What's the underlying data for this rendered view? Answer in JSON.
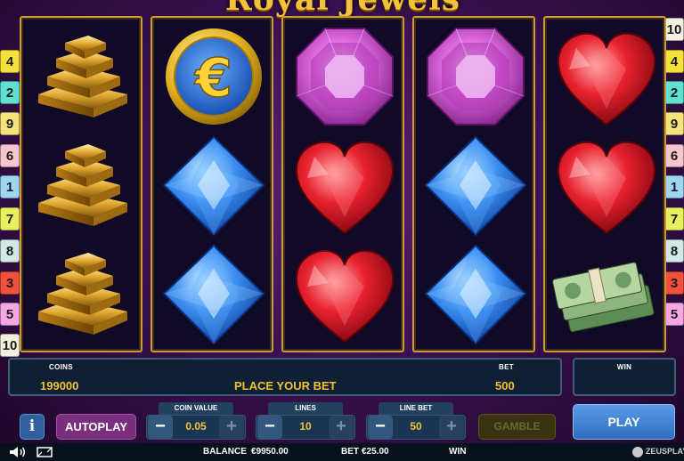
{
  "game": {
    "title": "Royal Jewels"
  },
  "paylines": {
    "left": [
      "4",
      "2",
      "9",
      "6",
      "1",
      "7",
      "8",
      "3",
      "5",
      "10"
    ],
    "right": [
      "10",
      "4",
      "2",
      "9",
      "6",
      "1",
      "7",
      "8",
      "3",
      "5"
    ]
  },
  "reels": [
    [
      "gold-bars",
      "gold-bars",
      "gold-bars"
    ],
    [
      "euro-coin",
      "blue-diamond",
      "blue-diamond"
    ],
    [
      "purple-gem",
      "red-heart",
      "red-heart"
    ],
    [
      "purple-gem",
      "blue-diamond",
      "blue-diamond"
    ],
    [
      "red-heart",
      "red-heart",
      "cash-bundle"
    ]
  ],
  "info_panel": {
    "coins_label": "COINS",
    "coins_value": "199000",
    "message": "PLACE YOUR BET",
    "bet_label": "BET",
    "bet_value": "500"
  },
  "win_panel": {
    "label": "WIN",
    "value": ""
  },
  "controls": {
    "info_label": "i",
    "autoplay_label": "AUTOPLAY",
    "coin_value": {
      "title": "COIN VALUE",
      "value": "0.05",
      "minus": "−",
      "plus": "+"
    },
    "lines": {
      "title": "LINES",
      "value": "10",
      "minus": "−",
      "plus": "+"
    },
    "line_bet": {
      "title": "LINE BET",
      "value": "50",
      "minus": "−",
      "plus": "+"
    },
    "gamble_label": "GAMBLE",
    "play_label": "PLAY"
  },
  "status_bar": {
    "balance_label": "BALANCE",
    "balance_value": "€9950.00",
    "bet_label": "BET",
    "bet_value": "€25.00",
    "win_label": "WIN",
    "brand": "ZEUSPLAY"
  },
  "colors": {
    "accent_gold": "#f1c232",
    "panel_bg": "#0f2034",
    "play_button": "#3d7fd1",
    "autoplay_button": "#7a2f7e"
  }
}
